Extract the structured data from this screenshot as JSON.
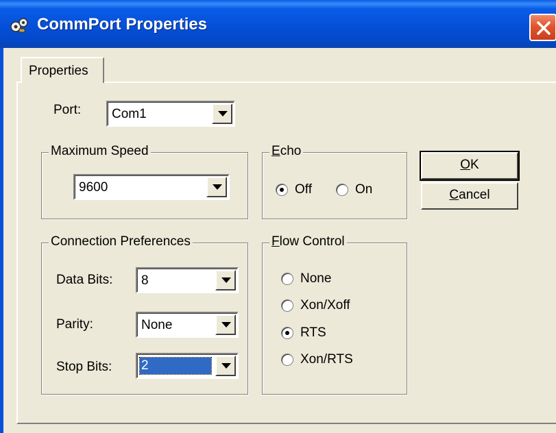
{
  "window": {
    "title": "CommPort Properties",
    "title_icon": "comm-port-icon",
    "close_icon": "close-icon"
  },
  "tabs": [
    {
      "label": "Properties",
      "selected": true
    }
  ],
  "port": {
    "label": "Port:",
    "value": "Com1"
  },
  "max_speed": {
    "legend": "Maximum Speed",
    "value": "9600"
  },
  "echo": {
    "legend_accel": "E",
    "legend_rest": "cho",
    "options": [
      {
        "label": "Off",
        "selected": true
      },
      {
        "label": "On",
        "selected": false
      }
    ]
  },
  "connection": {
    "legend": "Connection Preferences",
    "data_bits": {
      "label": "Data Bits:",
      "value": "8"
    },
    "parity": {
      "label": "Parity:",
      "value": "None"
    },
    "stop_bits": {
      "label": "Stop Bits:",
      "value": "2",
      "selected_text": true
    }
  },
  "flow_control": {
    "legend_accel": "F",
    "legend_rest": "low Control",
    "options": [
      {
        "label": "None",
        "selected": false
      },
      {
        "label": "Xon/Xoff",
        "selected": false
      },
      {
        "label": "RTS",
        "selected": true
      },
      {
        "label": "Xon/RTS",
        "selected": false
      }
    ]
  },
  "buttons": {
    "ok": {
      "accel": "O",
      "rest": "K"
    },
    "cancel": {
      "accel": "C",
      "rest": "ancel"
    }
  },
  "colors": {
    "title_bar": "#0550d8",
    "close_button": "#e0552f",
    "dialog_face": "#ece9d8",
    "selection": "#316ac5"
  }
}
